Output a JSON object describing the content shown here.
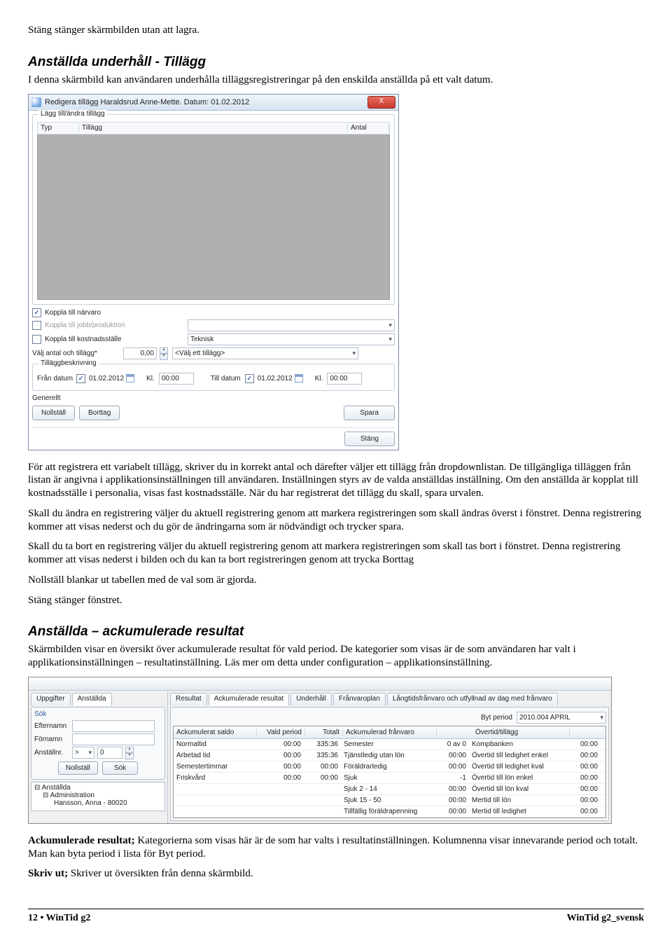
{
  "top_line": "Stäng stänger skärmbilden utan att lagra.",
  "section1": {
    "heading": "Anställda underhåll - Tillägg",
    "intro": "I denna skärmbild kan användaren underhålla tilläggsregistreringar på den enskilda anställda på ett valt datum."
  },
  "dialog1": {
    "title": "Redigera tillägg Haraldsrud Anne-Mette. Datum: 01.02.2012",
    "group_add": "Lägg till/ändra tillägg",
    "col_typ": "Typ",
    "col_tillagg": "Tillägg",
    "col_antal": "Antal",
    "chk_narvarro": "Koppla till närvaro",
    "chk_jobb": "Koppla till jobb/produktion",
    "chk_kostnad": "Koppla till kostnadsställe",
    "kostnad_value": "Teknisk",
    "lbl_valj": "Välj antal och tillägg*",
    "num_value": "0,00",
    "tillagg_placeholder": "<Välj ett tillägg>",
    "group_beskr": "Tilläggbeskrivning",
    "lbl_fran": "Från datum",
    "date_fran": "01.02.2012",
    "lbl_kl": "Kl.",
    "time1": "00:00",
    "lbl_till": "Till datum",
    "date_till": "01.02.2012",
    "time2": "00:00",
    "generellt": "Generellt",
    "btn_nollstall": "Nollställ",
    "btn_borttag": "Borttag",
    "btn_spara": "Spara",
    "btn_stang": "Stäng"
  },
  "body_after_dialog1": {
    "p1": "För att registrera ett variabelt tillägg, skriver du in korrekt antal och därefter väljer ett tillägg från dropdownlistan. De tillgängliga tilläggen från listan är angivna i applikationsinställningen till användaren. Inställningen styrs av de valda anställdas inställning. Om den anställda är kopplat till kostnadsställe i personalia, visas fast kostnadsställe. När du har registrerat det tillägg du skall, spara urvalen.",
    "p2": "Skall du ändra en registrering väljer du aktuell registrering genom att markera registreringen som skall ändras överst i fönstret. Denna registrering kommer att visas nederst och du gör de ändringarna som är nödvändigt och trycker spara.",
    "p3": "Skall du ta bort en registrering väljer du aktuell registrering genom att markera registreringen som skall tas bort i fönstret. Denna registrering kommer att visas nederst i bilden och du kan ta bort registreringen genom att trycka Borttag",
    "p4": "Nollställ blankar ut tabellen med de val som är gjorda.",
    "p5": "Stäng stänger fönstret."
  },
  "section2": {
    "heading": "Anställda – ackumulerade resultat",
    "intro": "Skärmbilden visar en översikt över ackumulerade resultat för vald period. De kategorier som visas är de som användaren har valt i applikationsinställningen – resultatinställning. Läs mer om detta under configuration – applikationsinställning."
  },
  "shot2": {
    "lefttabs": {
      "t1": "Uppgifter",
      "t2": "Anställda"
    },
    "righttabs": {
      "t1": "Resultat",
      "t2": "Ackumulerade resultat",
      "t3": "Underhåll",
      "t4": "Frånvaroplan",
      "t5": "Långtidsfrånvaro och utfyllnad av dag med frånvaro"
    },
    "search": {
      "sok": "Sök",
      "efternamn": "Efternamn",
      "fornamn": "Förnamn",
      "anstallnr": "Anställnr.",
      "gt": ">",
      "zero": "0",
      "btn_nollstall": "Nollställ",
      "btn_sok": "Sök"
    },
    "tree": {
      "root": "Anställda",
      "dept": "Administration",
      "emp": "Hansson, Anna - 80020"
    },
    "period_label": "Byt period",
    "period_value": "2010.004 APRIL",
    "headers": {
      "h1": "Ackumulerat saldo",
      "h2": "Vald period",
      "h3": "Totalt",
      "h4": "Ackumulerad frånvaro",
      "h5": "",
      "h6": "Övertid/tillägg",
      "h7": ""
    },
    "rows": [
      {
        "c1": "Normaltid",
        "c2": "00:00",
        "c3": "335:36",
        "c4": "Semester",
        "c5": "0 av 0",
        "c6": "Kompbanken",
        "c7": "00:00"
      },
      {
        "c1": "Arbetad tid",
        "c2": "00:00",
        "c3": "335:36",
        "c4": "Tjänstledig utan lön",
        "c5": "00:00",
        "c6": "Övertid till ledighet enkel",
        "c7": "00:00"
      },
      {
        "c1": "Semestertimmar",
        "c2": "00:00",
        "c3": "00:00",
        "c4": "Föräldrarledig",
        "c5": "00:00",
        "c6": "Övertid till ledighet kval",
        "c7": "00:00"
      },
      {
        "c1": "Friskvård",
        "c2": "00:00",
        "c3": "00:00",
        "c4": "Sjuk",
        "c5": "-1",
        "c6": "Övertid till lön enkel",
        "c7": "00:00"
      },
      {
        "c1": "",
        "c2": "",
        "c3": "",
        "c4": "Sjuk 2 - 14",
        "c5": "00:00",
        "c6": "Övertid till lön kval",
        "c7": "00:00"
      },
      {
        "c1": "",
        "c2": "",
        "c3": "",
        "c4": "Sjuk 15 - 50",
        "c5": "00:00",
        "c6": "Mertid till lön",
        "c7": "00:00"
      },
      {
        "c1": "",
        "c2": "",
        "c3": "",
        "c4": "Tillfällig föräldrapenning",
        "c5": "00:00",
        "c6": "Mertid till ledighet",
        "c7": "00:00"
      }
    ]
  },
  "body_after_shot2": {
    "p1_bold": "Ackumulerade resultat; ",
    "p1_rest": "Kategorierna som visas här är de som har valts i resultatinställningen.  Kolumnenna visar innevarande period och totalt. Man kan byta period i lista för Byt period.",
    "p2_bold": "Skriv ut; ",
    "p2_rest": "Skriver ut översikten från denna skärmbild."
  },
  "footer": {
    "left": "12  •  WinTid g2",
    "right": "WinTid g2_svensk"
  }
}
